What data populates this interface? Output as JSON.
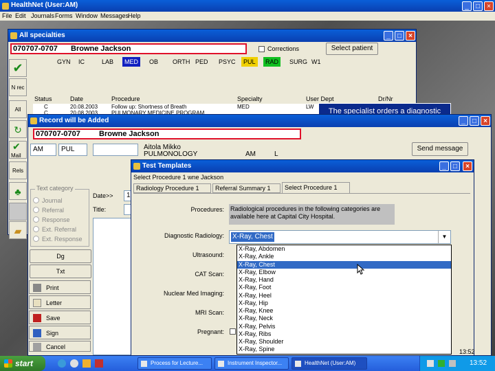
{
  "app": {
    "title": "HealthNet (User:AM)",
    "menu": [
      "File",
      "Edit",
      "Journals",
      "Forms",
      "Window",
      "Messages",
      "Help"
    ]
  },
  "specialties_window": {
    "title": "All specialties",
    "patient_id": "070707-0707",
    "patient_name": "Browne Jackson",
    "corrections_label": "Corrections",
    "select_patient_label": "Select patient",
    "tabs": [
      "GYN",
      "IC",
      "LAB",
      "MED",
      "OB",
      "ORTH",
      "PED",
      "PSYC",
      "PUL",
      "RAD",
      "SURG",
      "W1"
    ],
    "columns": [
      "Status",
      "Date",
      "Procedure",
      "Specialty",
      "User Dept",
      "Dr/Nr"
    ],
    "rows": [
      {
        "status": "C",
        "date": "20.08.2003",
        "procedure": "Follow up: Shortness of Breath",
        "specialty": "MED",
        "user": "LW"
      },
      {
        "status": "C",
        "date": "20.08.2003",
        "procedure": "PULMONARY MEDICINE PROGRAM",
        "specialty": "PUL",
        "user": "LW"
      }
    ],
    "side_labels": [
      "N rec",
      "All",
      "Mail",
      "Rels"
    ]
  },
  "callout": {
    "text": "The specialist orders a diagnostic radiology test using HealthNet template"
  },
  "record_window": {
    "title": "Record will be Added",
    "patient_id": "070707-0707",
    "patient_name": "Browne Jackson",
    "user_code": "AM",
    "dept_code": "PUL",
    "doctor_name": "Aitola Mikko",
    "doctor_dept": "PULMONOLOGY",
    "user_code2": "AM",
    "flag": "L",
    "send_message_label": "Send message",
    "text_category_label": "Text category",
    "categories": [
      "Journal",
      "Referral",
      "Response",
      "Ext. Referral",
      "Ext. Response"
    ],
    "date_label": "Date>>",
    "title_label": "Title:",
    "date_value": "1",
    "dg_label": "Dg",
    "txt_label": "Txt",
    "buttons": [
      "Print",
      "Letter",
      "Save",
      "Sign",
      "Cancel"
    ]
  },
  "test_templates": {
    "title": "Test Templates",
    "subtitle": "Select Procedure 1 wne Jackson",
    "tabs": [
      "Radiology Procedure 1",
      "Referral Summary 1",
      "Select Procedure 1"
    ],
    "procedures_label": "Procedures:",
    "procedures_text": "Radiological procedures in the following categories are available here at Capital City Hospital.",
    "diag_radiology_label": "Diagnostic Radiology:",
    "diag_radiology_value": "X-Ray, Chest",
    "ultrasound_label": "Ultrasound:",
    "cat_scan_label": "CAT Scan:",
    "nuclear_label": "Nuclear Med Imaging:",
    "mri_label": "MRI Scan:",
    "pregnant_label": "Pregnant:",
    "dropdown_options": [
      "X-Ray, Abdomen",
      "X-Ray, Ankle",
      "X-Ray, Chest",
      "X-Ray, Elbow",
      "X-Ray, Hand",
      "X-Ray, Foot",
      "X-Ray, Heel",
      "X-Ray, Hip",
      "X-Ray, Knee",
      "X-Ray, Neck",
      "X-Ray, Pelvis",
      "X-Ray, Ribs",
      "X-Ray, Shoulder",
      "X-Ray, Spine"
    ],
    "selected_option": "X-Ray, Chest"
  },
  "taskbar": {
    "start_label": "start",
    "tasks": [
      "Process for Lecture...",
      "Instrument Inspector...",
      "HealthNet (User:AM)"
    ],
    "clock": "13:52",
    "status_time": "13:52"
  },
  "colors": {
    "title_blue": "#0a4fc8",
    "highlight_red": "#e0102a",
    "tab_med": "#1020c0",
    "tab_pul": "#f0d000",
    "tab_rad": "#10c020",
    "selection": "#316ac5",
    "callout_bg": "#0b2a8c"
  }
}
